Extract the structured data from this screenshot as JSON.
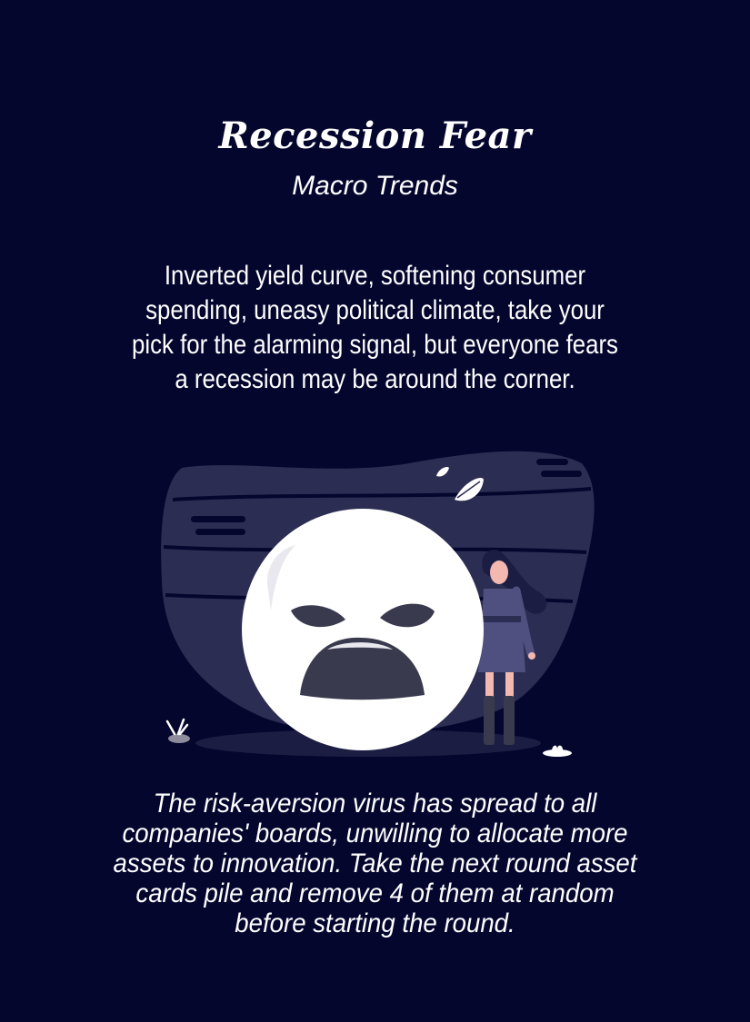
{
  "card": {
    "title": "Recession Fear",
    "category": "Macro Trends",
    "description": "Inverted yield curve, softening consumer spending, uneasy political climate, take your pick for the alarming signal, but everyone fears a recession may be around the corner.",
    "effect": "The risk-aversion virus has spread to all companies' boards, unwilling to allocate more assets to innovation. Take the next round asset cards pile and remove 4 of them at random before starting the round."
  },
  "colors": {
    "background": "#04062e",
    "text": "#ffffff",
    "illustration_shade": "#2c2d52",
    "face": "#ffffff",
    "face_features": "#3a3a4e",
    "dress": "#4f4f80"
  },
  "icons": {
    "face": "sad-face-illustration",
    "person": "woman-figure-illustration",
    "leaf": "leaf-icon"
  }
}
